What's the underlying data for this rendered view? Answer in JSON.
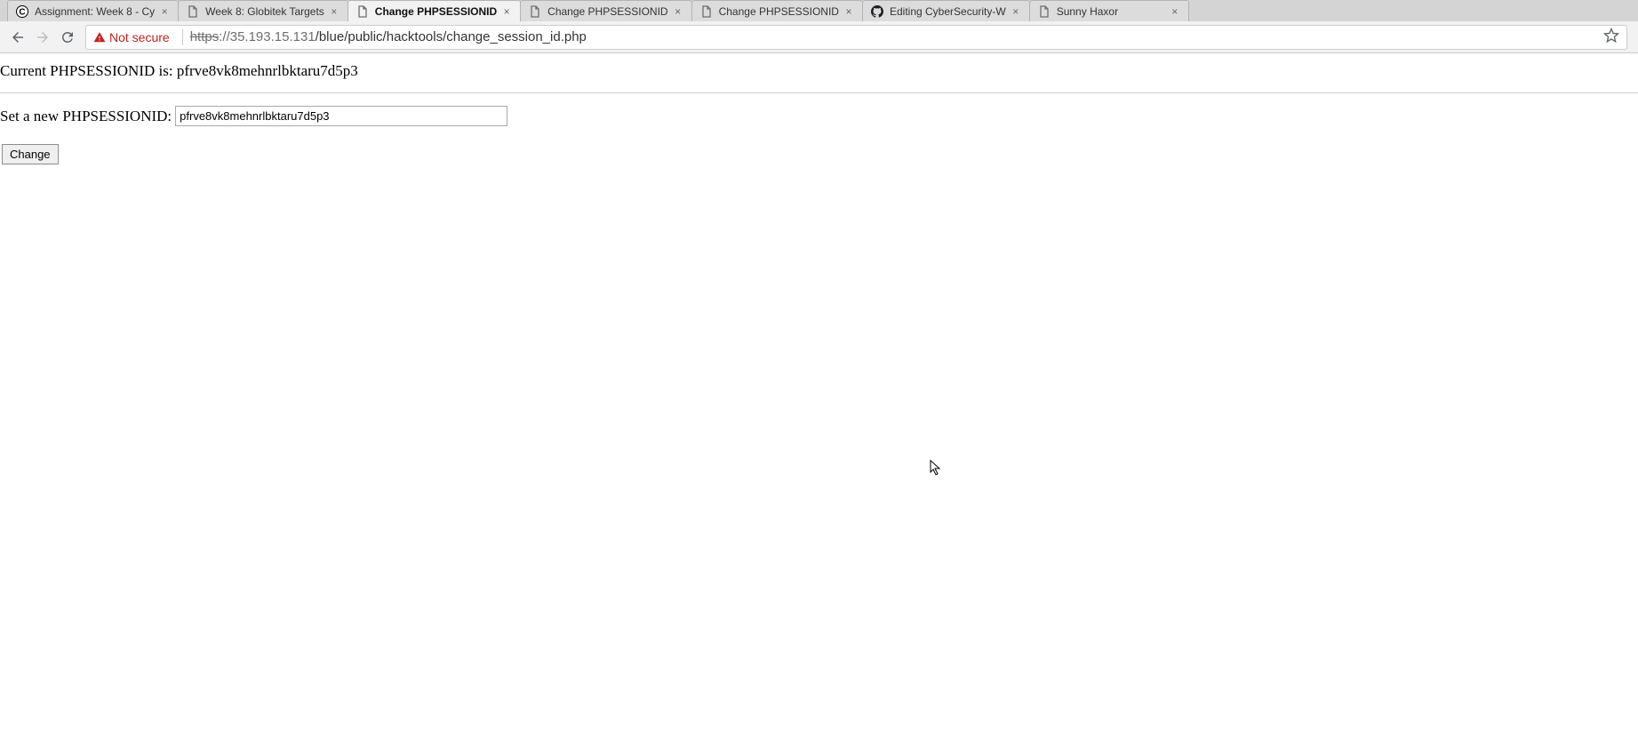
{
  "tabs": [
    {
      "title": "Assignment: Week 8 - Cy",
      "icon": "c-letter"
    },
    {
      "title": "Week 8: Globitek Targets",
      "icon": "page"
    },
    {
      "title": "Change PHPSESSIONID",
      "icon": "page",
      "active": true
    },
    {
      "title": "Change PHPSESSIONID",
      "icon": "page"
    },
    {
      "title": "Change PHPSESSIONID",
      "icon": "page"
    },
    {
      "title": "Editing CyberSecurity-W",
      "icon": "github"
    },
    {
      "title": "Sunny Haxor",
      "icon": "page"
    }
  ],
  "address_bar": {
    "security_label": "Not secure",
    "protocol": "https",
    "after_protocol": "://35.193.15.131",
    "path": "/blue/public/hacktools/change_session_id.php"
  },
  "page": {
    "current_label": "Current PHPSESSIONID is: ",
    "current_value": "pfrve8vk8mehnrlbktaru7d5p3",
    "set_label": "Set a new PHPSESSIONID: ",
    "input_value": "pfrve8vk8mehnrlbktaru7d5p3",
    "button_label": "Change"
  }
}
